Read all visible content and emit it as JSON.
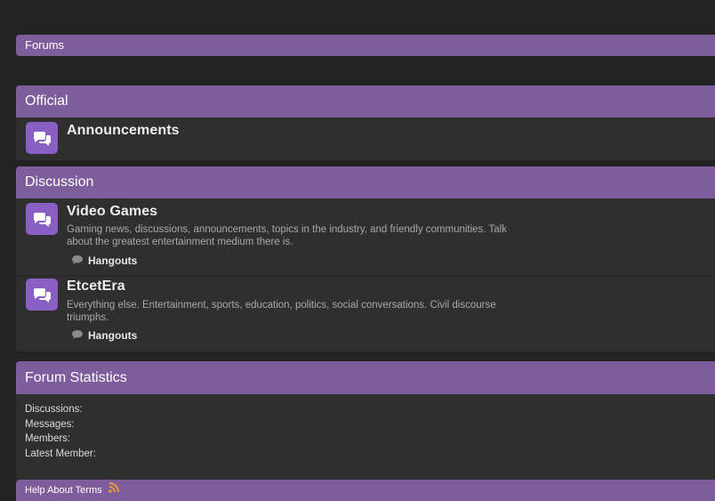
{
  "breadcrumb": {
    "label": "Forums"
  },
  "categories": [
    {
      "title": "Official",
      "forums": [
        {
          "title": "Announcements",
          "description": "",
          "subforums": []
        }
      ]
    },
    {
      "title": "Discussion",
      "forums": [
        {
          "title": "Video Games",
          "description": "Gaming news, discussions, announcements, topics in the industry, and friendly communities. Talk about the greatest entertainment medium there is.",
          "subforums": [
            "Hangouts"
          ]
        },
        {
          "title": "EtcetEra",
          "description": "Everything else. Entertainment, sports, education, politics, social conversations. Civil discourse triumphs.",
          "subforums": [
            "Hangouts"
          ]
        }
      ]
    }
  ],
  "statistics": {
    "title": "Forum Statistics",
    "rows": [
      "Discussions:",
      "Messages:",
      "Members:",
      "Latest Member:"
    ]
  },
  "footer": {
    "label": "Help  About  Terms"
  },
  "colors": {
    "accent": "#7e5d9d",
    "icon": "#8a5fc4",
    "panel": "#2f2f2f",
    "page": "#232323"
  },
  "icons": {
    "forum": "chat-bubbles-icon",
    "subforum": "speech-bubble-icon",
    "rss": "rss-icon"
  }
}
